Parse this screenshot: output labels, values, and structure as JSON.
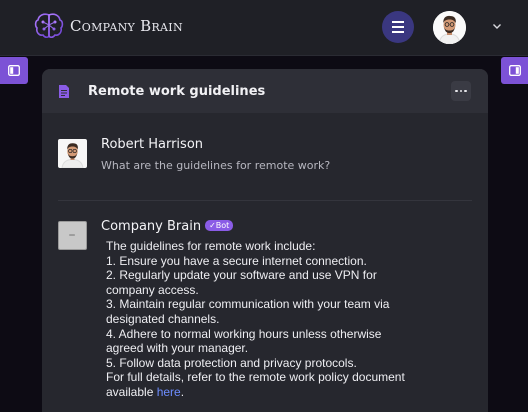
{
  "app": {
    "brand_name": "Company Brain"
  },
  "header": {
    "menu_icon": "hamburger-icon",
    "profile_dropdown_icon": "chevron-down-icon"
  },
  "sidebar_toggles": {
    "left_icon": "sidebar-panel-icon",
    "right_icon": "sidebar-panel-icon"
  },
  "doc": {
    "title": "Remote work guidelines",
    "more_icon": "more-horizontal-icon"
  },
  "messages": [
    {
      "author": "Robert Harrison",
      "text": "What are the guidelines for remote work?"
    },
    {
      "author": "Company Brain",
      "badge": "✓Bot",
      "lines": [
        "The guidelines for remote work include:",
        "1. Ensure you have a secure internet connection.",
        "2. Regularly update your software and use VPN for",
        "company access.",
        "3. Maintain regular communication with your team via",
        "designated channels.",
        "4. Adhere to normal working hours unless otherwise",
        "agreed with your manager.",
        "5. Follow data protection and privacy protocols.",
        "For full details, refer to the remote work policy document"
      ],
      "last_line_prefix": "available ",
      "link_text": "here",
      "last_line_suffix": "."
    }
  ],
  "colors": {
    "accent": "#7c52d6",
    "link": "#6d8dff",
    "menu_button": "#3a3780"
  }
}
